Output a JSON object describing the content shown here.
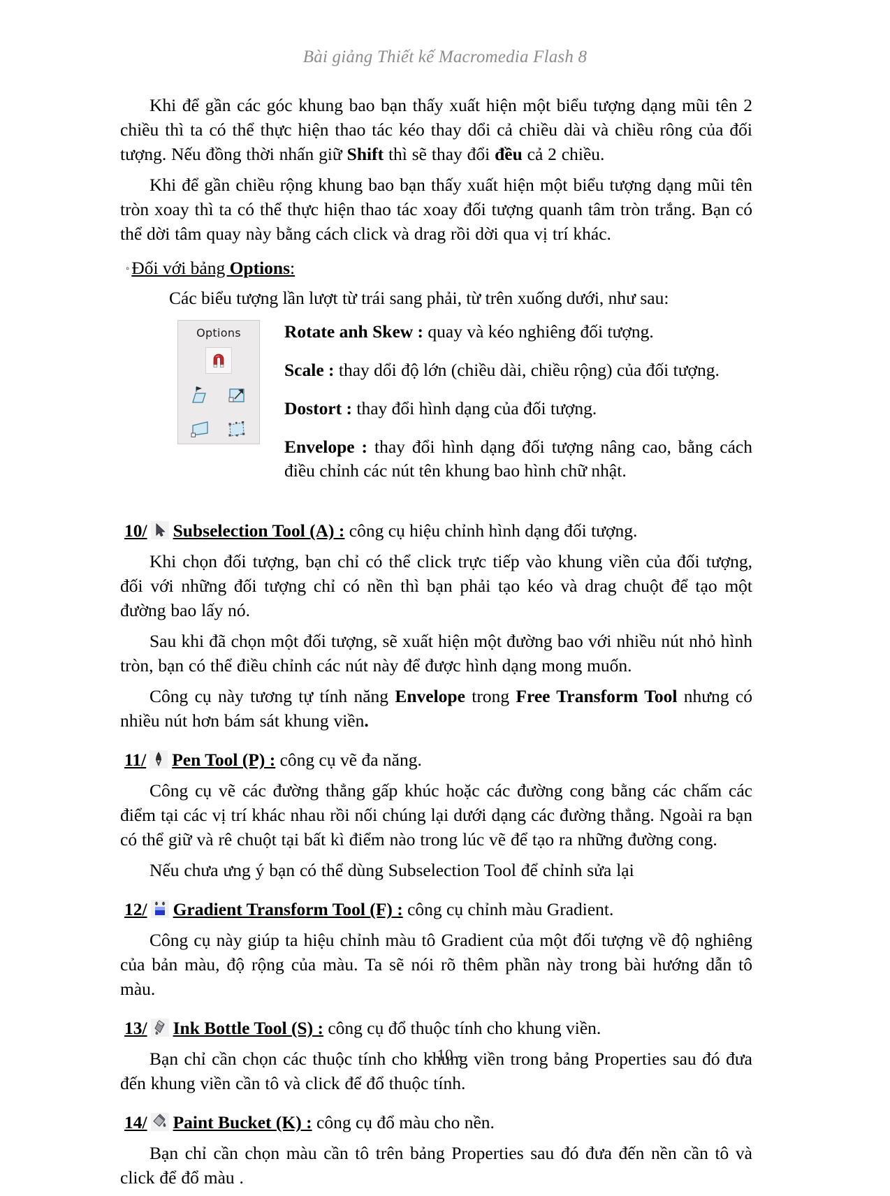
{
  "header": {
    "running_title": "Bài giảng Thiết kế Macromedia Flash 8"
  },
  "footer": {
    "page_number": "- 10 -"
  },
  "paragraphs": {
    "p1_a": "Khi để gần các góc khung bao bạn thấy xuất hiện một  biểu tượng dạng mũi tên 2 chiều thì ta có thể thực hiện thao tác kéo thay dổi cả chiều dài và chiều rông của đối tượng. Nếu đồng thời nhấn giữ ",
    "p1_b": "Shift",
    "p1_c": " thì sẽ thay đổi ",
    "p1_d": "đều",
    "p1_e": " cả 2 chiều.",
    "p2": "Khi để gần chiều rộng khung bao bạn thấy xuất hiện một  biểu tượng dạng mũi tên tròn xoay thì ta có thể thực hiện thao tác xoay đối tượng quanh tâm tròn trắng. Bạn có thể dời tâm quay này bằng cách click và drag rồi dời qua vị trí khác."
  },
  "options_section": {
    "bullet": "◦",
    "heading_prefix": "Đối với bảng ",
    "heading_bold": "Options",
    "heading_suffix": ":",
    "intro": "Các biểu tượng lần lượt từ trái sang phải, từ trên xuống dưới, như sau:",
    "panel": {
      "title": "Options",
      "icons": [
        "magnet-snap-icon",
        "rotate-skew-icon",
        "scale-icon",
        "distort-icon",
        "envelope-icon"
      ]
    },
    "definitions": [
      {
        "term": "Rotate anh Skew :",
        "desc": " quay và kéo nghiêng đối tượng."
      },
      {
        "term": "Scale :",
        "desc": " thay dổi độ lớn (chiều dài, chiều rộng) của đối tượng."
      },
      {
        "term": "Dostort :",
        "desc": " thay đổi hình dạng của đối tượng."
      },
      {
        "term": "Envelope :",
        "desc": " thay đổi hình dạng đối tượng nâng cao, bằng cách điều chỉnh các nút tên khung bao hình chữ nhật."
      }
    ]
  },
  "tools": [
    {
      "num": "10/",
      "icon": "subselection-arrow-icon",
      "name": "Subselection Tool (A) :",
      "desc": " công cụ hiệu chỉnh hình dạng đối tượng.",
      "body": [
        "Khi chọn đối tượng, bạn chỉ có thể click trực tiếp vào khung viền của đối tượng, đối với những đối tượng chỉ có nền thì bạn phải tạo kéo và drag chuột để tạo một đường bao lấy nó.",
        "Sau khi đã chọn một đối tượng, sẽ xuất hiện một đường bao với nhiều nút nhỏ hình tròn, bạn có thể điều chỉnh các nút này để được hình dạng mong muốn."
      ],
      "body_rich": {
        "pre": "Công cụ này tương tự tính năng ",
        "b1": "Envelope",
        "mid": " trong ",
        "b2": "Free Transform Tool",
        "post": " nhưng có nhiều nút hơn bám sát khung viền",
        "tail": "."
      }
    },
    {
      "num": "11/",
      "icon": "pen-tool-icon",
      "name": "Pen Tool (P) :",
      "desc": " công cụ vẽ đa năng.",
      "body": [
        "Công cụ vẽ các đường thẳng gấp khúc hoặc các đường cong bằng các chấm các điểm tại các vị trí khác nhau rồi nối chúng lại dưới dạng các đường thẳng. Ngoài ra bạn có thể giữ và rê chuột tại bất kì điểm nào trong lúc vẽ để tạo ra những đường cong.",
        "Nếu chưa ưng ý bạn có thể dùng Subselection Tool để chỉnh sửa lại"
      ]
    },
    {
      "num": "12/",
      "icon": "gradient-transform-icon",
      "name": "Gradient Transform Tool (F) :",
      "desc": " công cụ chỉnh màu Gradient.",
      "body": [
        "Công cụ này giúp ta hiệu chỉnh màu tô Gradient của một đối tượng về độ nghiêng của bản màu, độ rộng của màu. Ta sẽ nói rõ thêm phần này trong bài hướng dẫn tô màu."
      ]
    },
    {
      "num": "13/",
      "icon": "ink-bottle-icon",
      "name": "Ink Bottle Tool (S) :",
      "desc": " công cụ đổ thuộc tính cho khung viền.",
      "body": [
        "Bạn chỉ cần chọn các thuộc tính cho khung viền trong bảng Properties sau đó đưa đến khung viền cần tô và click để đổ thuộc tính."
      ]
    },
    {
      "num": "14/",
      "icon": "paint-bucket-icon",
      "name": "Paint Bucket (K) :",
      "desc": " công cụ đổ màu cho nền.",
      "body": [
        "Bạn chỉ cần chọn màu cần tô trên bảng Properties sau đó đưa đến nền cần tô và click để đổ màu ."
      ]
    }
  ],
  "colors": {
    "header_gray": "#8c8c8c",
    "magnet_red": "#c2282b",
    "tool_blue": "#5fa8cf",
    "panel_bg": "#eceaea"
  }
}
